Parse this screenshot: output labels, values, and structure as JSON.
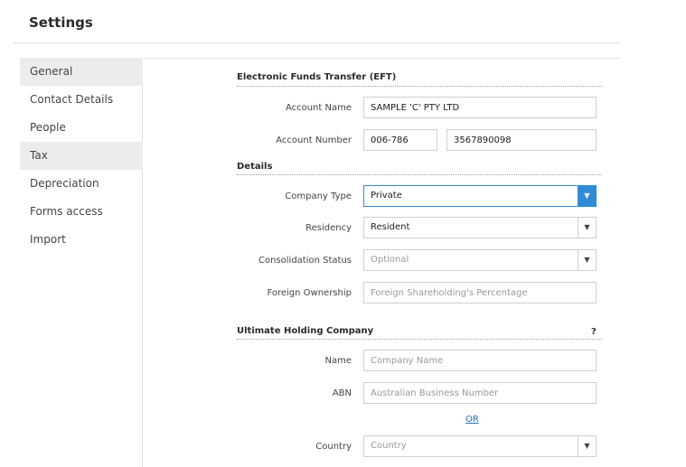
{
  "page": {
    "title": "Settings"
  },
  "sidebar": {
    "items": [
      {
        "label": "General",
        "active": true
      },
      {
        "label": "Contact Details",
        "active": false
      },
      {
        "label": "People",
        "active": false
      },
      {
        "label": "Tax",
        "active": true
      },
      {
        "label": "Depreciation",
        "active": false
      },
      {
        "label": "Forms access",
        "active": false
      },
      {
        "label": "Import",
        "active": false
      }
    ]
  },
  "eft": {
    "title": "Electronic Funds Transfer (EFT)",
    "account_name": {
      "label": "Account Name",
      "value": "SAMPLE 'C' PTY LTD"
    },
    "account_number": {
      "label": "Account Number",
      "bsb": "006-786",
      "number": "3567890098"
    }
  },
  "details": {
    "title": "Details",
    "company_type": {
      "label": "Company Type",
      "value": "Private"
    },
    "residency": {
      "label": "Residency",
      "value": "Resident"
    },
    "consolidation_status": {
      "label": "Consolidation Status",
      "placeholder": "Optional"
    },
    "foreign_ownership": {
      "label": "Foreign Ownership",
      "placeholder": "Foreign Shareholding's Percentage"
    }
  },
  "holding": {
    "title": "Ultimate Holding Company",
    "help": "?",
    "name": {
      "label": "Name",
      "placeholder": "Company Name"
    },
    "abn": {
      "label": "ABN",
      "placeholder": "Australian Business Number"
    },
    "or_label": "OR",
    "country": {
      "label": "Country",
      "placeholder": "Country"
    }
  },
  "icons": {
    "dropdown": "chevron-down-icon",
    "help": "help-icon"
  },
  "colors": {
    "accent": "#2f8bd6",
    "link": "#2a72b5",
    "active_item": "#ececec"
  }
}
